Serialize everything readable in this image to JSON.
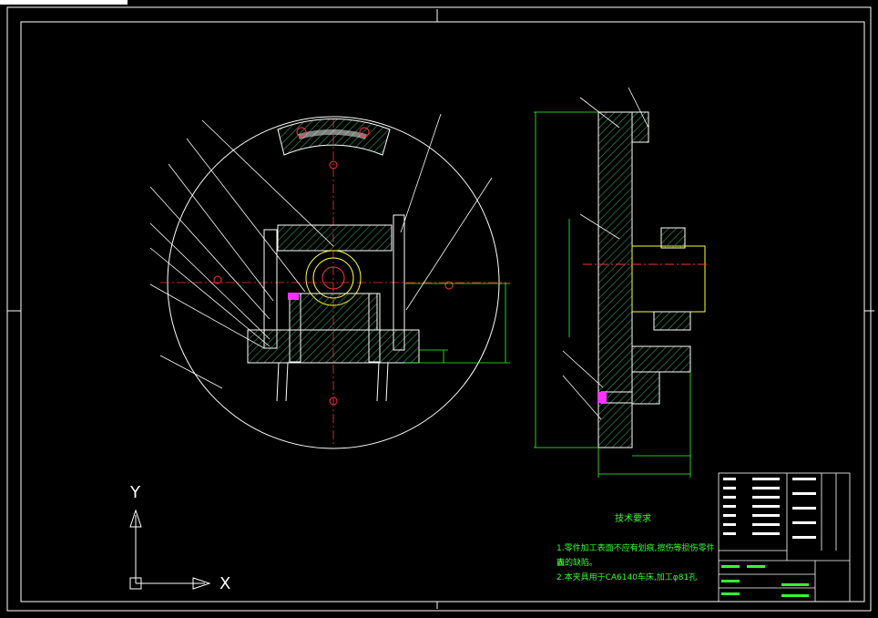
{
  "notes": {
    "title": "技术要求",
    "line1": "1.零件加工表面不应有划痕,擦伤等损伤零件表",
    "line2": "面的缺陷。",
    "line3": "2.本夹具用于CA6140车床,加工φ81孔"
  },
  "axes": {
    "x": "X",
    "y": "Y"
  },
  "colors": {
    "background": "#000000",
    "line": "#ffffff",
    "hatch": "#2e8b57",
    "centerline": "#ff3333",
    "dimension": "#33ff33",
    "highlight": "#ffff33",
    "accent": "#ff33ff"
  }
}
